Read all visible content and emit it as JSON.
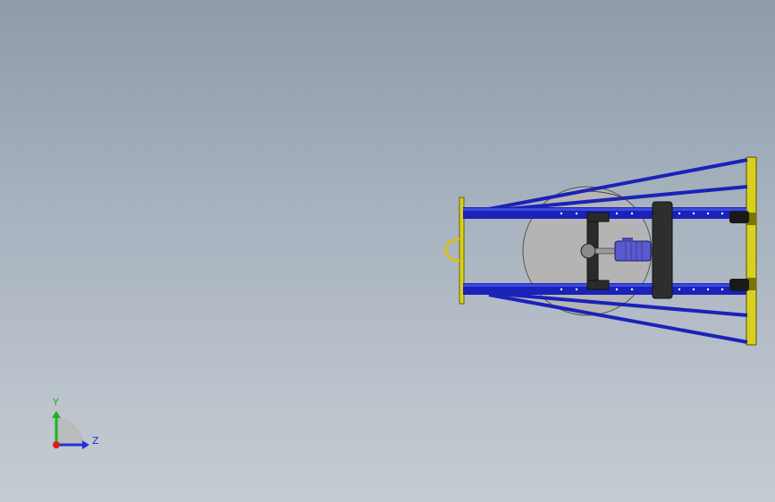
{
  "viewport": {
    "background_top": "#8e9bab",
    "background_bottom": "#c6ccd3"
  },
  "model": {
    "frame_color": "#1a22b8",
    "frame_highlight": "#3d4ae0",
    "end_plate_color": "#d8d020",
    "bracket_color": "#2a2a2a",
    "disk_color": "#b4b4b4",
    "motor_color": "#5a5ad0",
    "handle_color": "#d6c020"
  },
  "triad": {
    "y_label": "Y",
    "z_label": "Z",
    "y_color": "#1fb21f",
    "z_color": "#2830d8",
    "origin_color": "#d82020",
    "icon": "coordinate-triad-icon"
  }
}
